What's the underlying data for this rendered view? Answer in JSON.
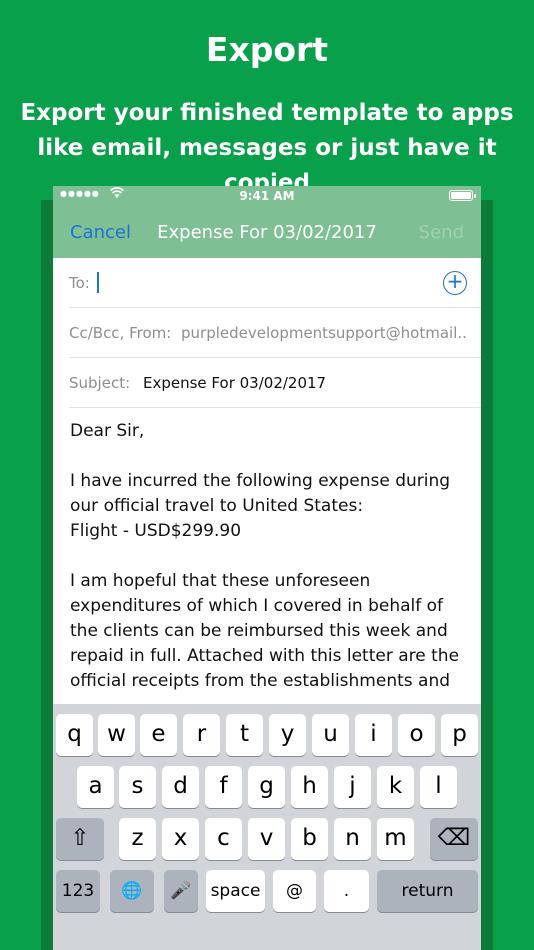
{
  "promo": {
    "title": "Export",
    "subtitle_line1": "Export your finished template to apps",
    "subtitle_line2": "like email, messages or just have it copied"
  },
  "status_bar": {
    "signal": "●●●●●",
    "time": "9:41 AM"
  },
  "nav": {
    "cancel": "Cancel",
    "title": "Expense For 03/02/2017",
    "send": "Send"
  },
  "fields": {
    "to_label": "To:",
    "cc_label": "Cc/Bcc, From:",
    "cc_value": "purpledevelopmentsupport@hotmail...",
    "subject_label": "Subject:",
    "subject_value": "Expense For 03/02/2017"
  },
  "body": {
    "greeting": "Dear Sir,",
    "para1_line1": "I have incurred the following expense during",
    "para1_line2": "our official travel to United States:",
    "para1_line3": "Flight - USD$299.90",
    "para2_line1": "I am hopeful that these unforeseen",
    "para2_line2": "expenditures of which I covered in behalf of",
    "para2_line3": "the clients can be reimbursed this week and",
    "para2_line4": "repaid in full. Attached with this letter are the",
    "para2_line5": "official receipts from the establishments and"
  },
  "keyboard": {
    "row1": [
      "q",
      "w",
      "e",
      "r",
      "t",
      "y",
      "u",
      "i",
      "o",
      "p"
    ],
    "row2": [
      "a",
      "s",
      "d",
      "f",
      "g",
      "h",
      "j",
      "k",
      "l"
    ],
    "row3": [
      "z",
      "x",
      "c",
      "v",
      "b",
      "n",
      "m"
    ],
    "shift": "⇧",
    "delete": "⌫",
    "numbers": "123",
    "globe": "🌐",
    "mic": "🎤",
    "space": "space",
    "at": "@",
    "period": ".",
    "return": "return"
  }
}
